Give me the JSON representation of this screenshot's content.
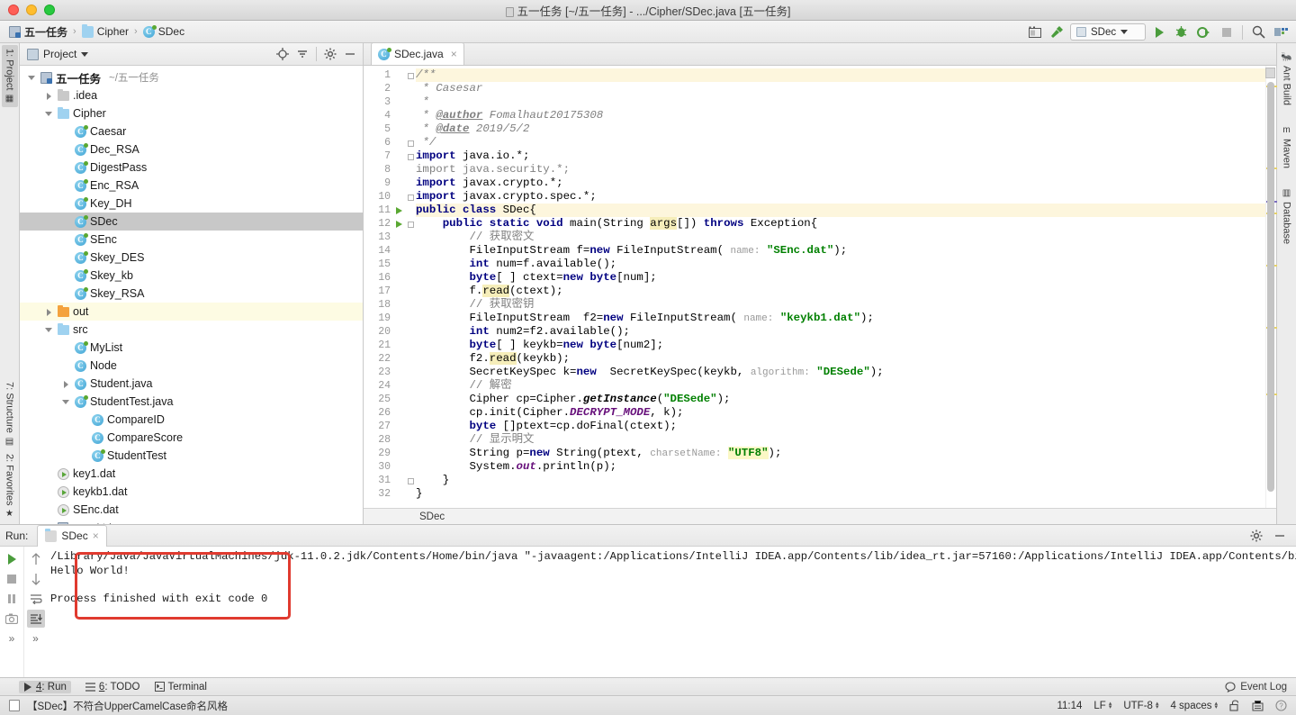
{
  "window": {
    "title": "五一任务 [~/五一任务] - .../Cipher/SDec.java [五一任务]",
    "traffic": [
      "close",
      "minimize",
      "maximize"
    ]
  },
  "breadcrumb": [
    {
      "label": "五一任务",
      "icon": "module-icon"
    },
    {
      "label": "Cipher",
      "icon": "folder-icon"
    },
    {
      "label": "SDec",
      "icon": "java-class-icon"
    }
  ],
  "toolbar": {
    "run_config": "SDec",
    "buttons": [
      "layout-icon",
      "build-icon",
      "run-icon",
      "debug-icon",
      "run-coverage-icon",
      "stop-icon",
      "search-icon",
      "project-structure-icon"
    ]
  },
  "left_rail": {
    "top": [
      "1: Project"
    ],
    "bottom": [
      "7: Structure",
      "2: Favorites"
    ]
  },
  "right_rail": [
    "Ant Build",
    "Maven",
    "Database"
  ],
  "project_panel": {
    "title": "Project",
    "header_buttons": [
      "locate-icon",
      "collapse-all-icon",
      "settings-icon",
      "hide-icon"
    ],
    "tree": [
      {
        "label": "五一任务",
        "suffix": "~/五一任务",
        "icon": "module-icon",
        "indent": 0,
        "arrow": "down",
        "bold": true,
        "state": "normal"
      },
      {
        "label": ".idea",
        "suffix": "",
        "icon": "folder-gray-icon",
        "indent": 1,
        "arrow": "right",
        "bold": false,
        "state": "normal"
      },
      {
        "label": "Cipher",
        "suffix": "",
        "icon": "folder-blue-icon",
        "indent": 1,
        "arrow": "down",
        "bold": false,
        "state": "normal"
      },
      {
        "label": "Caesar",
        "suffix": "",
        "icon": "java-class-icon",
        "indent": 2,
        "arrow": "none",
        "bold": false,
        "state": "normal"
      },
      {
        "label": "Dec_RSA",
        "suffix": "",
        "icon": "java-class-icon",
        "indent": 2,
        "arrow": "none",
        "bold": false,
        "state": "normal"
      },
      {
        "label": "DigestPass",
        "suffix": "",
        "icon": "java-class-icon",
        "indent": 2,
        "arrow": "none",
        "bold": false,
        "state": "normal"
      },
      {
        "label": "Enc_RSA",
        "suffix": "",
        "icon": "java-class-icon",
        "indent": 2,
        "arrow": "none",
        "bold": false,
        "state": "normal"
      },
      {
        "label": "Key_DH",
        "suffix": "",
        "icon": "java-class-icon",
        "indent": 2,
        "arrow": "none",
        "bold": false,
        "state": "normal"
      },
      {
        "label": "SDec",
        "suffix": "",
        "icon": "java-class-icon",
        "indent": 2,
        "arrow": "none",
        "bold": false,
        "state": "selected"
      },
      {
        "label": "SEnc",
        "suffix": "",
        "icon": "java-class-icon",
        "indent": 2,
        "arrow": "none",
        "bold": false,
        "state": "normal"
      },
      {
        "label": "Skey_DES",
        "suffix": "",
        "icon": "java-class-icon",
        "indent": 2,
        "arrow": "none",
        "bold": false,
        "state": "normal"
      },
      {
        "label": "Skey_kb",
        "suffix": "",
        "icon": "java-class-icon",
        "indent": 2,
        "arrow": "none",
        "bold": false,
        "state": "normal"
      },
      {
        "label": "Skey_RSA",
        "suffix": "",
        "icon": "java-class-icon",
        "indent": 2,
        "arrow": "none",
        "bold": false,
        "state": "normal"
      },
      {
        "label": "out",
        "suffix": "",
        "icon": "folder-orange-icon",
        "indent": 1,
        "arrow": "right",
        "bold": false,
        "state": "highlighted"
      },
      {
        "label": "src",
        "suffix": "",
        "icon": "folder-blue-icon",
        "indent": 1,
        "arrow": "down",
        "bold": false,
        "state": "normal"
      },
      {
        "label": "MyList",
        "suffix": "",
        "icon": "java-class-icon",
        "indent": 2,
        "arrow": "none",
        "bold": false,
        "state": "normal"
      },
      {
        "label": "Node",
        "suffix": "",
        "icon": "java-class-plain-icon",
        "indent": 2,
        "arrow": "none",
        "bold": false,
        "state": "normal"
      },
      {
        "label": "Student.java",
        "suffix": "",
        "icon": "java-class-plain-icon",
        "indent": 2,
        "arrow": "right",
        "bold": false,
        "state": "normal"
      },
      {
        "label": "StudentTest.java",
        "suffix": "",
        "icon": "java-class-icon",
        "indent": 2,
        "arrow": "down",
        "bold": false,
        "state": "normal"
      },
      {
        "label": "CompareID",
        "suffix": "",
        "icon": "java-class-plain-icon",
        "indent": 3,
        "arrow": "none",
        "bold": false,
        "state": "normal"
      },
      {
        "label": "CompareScore",
        "suffix": "",
        "icon": "java-class-plain-icon",
        "indent": 3,
        "arrow": "none",
        "bold": false,
        "state": "normal"
      },
      {
        "label": "StudentTest",
        "suffix": "",
        "icon": "java-class-icon",
        "indent": 3,
        "arrow": "none",
        "bold": false,
        "state": "normal"
      },
      {
        "label": "key1.dat",
        "suffix": "",
        "icon": "dat-file-icon",
        "indent": 1,
        "arrow": "none",
        "bold": false,
        "state": "normal"
      },
      {
        "label": "keykb1.dat",
        "suffix": "",
        "icon": "dat-file-icon",
        "indent": 1,
        "arrow": "none",
        "bold": false,
        "state": "normal"
      },
      {
        "label": "SEnc.dat",
        "suffix": "",
        "icon": "dat-file-icon",
        "indent": 1,
        "arrow": "none",
        "bold": false,
        "state": "normal"
      },
      {
        "label": "五一任务.iml",
        "suffix": "",
        "icon": "iml-file-icon",
        "indent": 1,
        "arrow": "none",
        "bold": false,
        "state": "normal"
      }
    ]
  },
  "editor": {
    "tab": {
      "label": "SDec.java",
      "icon": "java-class-icon",
      "close": "×"
    },
    "breadcrumb": "SDec",
    "first_line": 1,
    "last_line": 32,
    "lines": [
      {
        "n": 1,
        "html": "<span class=\"cm\">/**</span>",
        "run": false,
        "fold": "open",
        "hl": true
      },
      {
        "n": 2,
        "html": "<span class=\"cm\"> * Casesar</span>",
        "run": false,
        "fold": "",
        "hl": false
      },
      {
        "n": 3,
        "html": "<span class=\"cm\"> *</span>",
        "run": false,
        "fold": "",
        "hl": false
      },
      {
        "n": 4,
        "html": "<span class=\"cm\"> * </span><span class=\"tag\">@author</span><span class=\"cm\"> Fomalhaut20175308</span>",
        "run": false,
        "fold": "",
        "hl": false
      },
      {
        "n": 5,
        "html": "<span class=\"cm\"> * </span><span class=\"tag\">@date</span><span class=\"cm\"> 2019/5/2</span>",
        "run": false,
        "fold": "",
        "hl": false
      },
      {
        "n": 6,
        "html": "<span class=\"cm\"> */</span>",
        "run": false,
        "fold": "close",
        "hl": false
      },
      {
        "n": 7,
        "html": "<span class=\"kw\">import</span> java.io.*;",
        "run": false,
        "fold": "open",
        "hl": false
      },
      {
        "n": 8,
        "html": "<span class=\"cmt\">import java.security.*;</span>",
        "run": false,
        "fold": "",
        "hl": false
      },
      {
        "n": 9,
        "html": "<span class=\"kw\">import</span> javax.crypto.*;",
        "run": false,
        "fold": "",
        "hl": false
      },
      {
        "n": 10,
        "html": "<span class=\"kw\">import</span> javax.crypto.spec.*;",
        "run": false,
        "fold": "close",
        "hl": false
      },
      {
        "n": 11,
        "html": "<span class=\"kw\">public class</span> SDec{",
        "run": true,
        "fold": "",
        "hl": true
      },
      {
        "n": 12,
        "html": "    <span class=\"kw\">public static void</span> main(String <span class=\"hlw\">args</span>[]) <span class=\"kw\">throws</span> Exception{",
        "run": true,
        "fold": "open",
        "hl": false
      },
      {
        "n": 13,
        "html": "        <span class=\"cmt\">// 获取密文</span>",
        "run": false,
        "fold": "",
        "hl": false
      },
      {
        "n": 14,
        "html": "        FileInputStream f=<span class=\"kw\">new</span> FileInputStream( <span class=\"hint\">name:</span> <span class=\"str\">\"SEnc.dat\"</span>);",
        "run": false,
        "fold": "",
        "hl": false
      },
      {
        "n": 15,
        "html": "        <span class=\"kw\">int</span> num=f.available();",
        "run": false,
        "fold": "",
        "hl": false
      },
      {
        "n": 16,
        "html": "        <span class=\"kw\">byte</span>[ ] ctext=<span class=\"kw\">new</span> <span class=\"kw\">byte</span>[num];",
        "run": false,
        "fold": "",
        "hl": false
      },
      {
        "n": 17,
        "html": "        f.<span class=\"hlw\">read</span>(ctext);",
        "run": false,
        "fold": "",
        "hl": false
      },
      {
        "n": 18,
        "html": "        <span class=\"cmt\">// 获取密钥</span>",
        "run": false,
        "fold": "",
        "hl": false
      },
      {
        "n": 19,
        "html": "        FileInputStream  f2=<span class=\"kw\">new</span> FileInputStream( <span class=\"hint\">name:</span> <span class=\"str\">\"keykb1.dat\"</span>);",
        "run": false,
        "fold": "",
        "hl": false
      },
      {
        "n": 20,
        "html": "        <span class=\"kw\">int</span> num2=f2.available();",
        "run": false,
        "fold": "",
        "hl": false
      },
      {
        "n": 21,
        "html": "        <span class=\"kw\">byte</span>[ ] keykb=<span class=\"kw\">new</span> <span class=\"kw\">byte</span>[num2];",
        "run": false,
        "fold": "",
        "hl": false
      },
      {
        "n": 22,
        "html": "        f2.<span class=\"hlw\">read</span>(keykb);",
        "run": false,
        "fold": "",
        "hl": false
      },
      {
        "n": 23,
        "html": "        SecretKeySpec k=<span class=\"kw\">new</span>  SecretKeySpec(keykb, <span class=\"hint\">algorithm:</span> <span class=\"str\">\"DESede\"</span>);",
        "run": false,
        "fold": "",
        "hl": false
      },
      {
        "n": 24,
        "html": "        <span class=\"cmt\">// 解密</span>",
        "run": false,
        "fold": "",
        "hl": false
      },
      {
        "n": 25,
        "html": "        Cipher cp=Cipher.<span class=\"ital\">getInstance</span>(<span class=\"str\">\"DESede\"</span>);",
        "run": false,
        "fold": "",
        "hl": false
      },
      {
        "n": 26,
        "html": "        cp.init(Cipher.<span class=\"field\">DECRYPT_MODE</span>, k);",
        "run": false,
        "fold": "",
        "hl": false
      },
      {
        "n": 27,
        "html": "        <span class=\"kw\">byte</span> []ptext=cp.doFinal(ctext);",
        "run": false,
        "fold": "",
        "hl": false
      },
      {
        "n": 28,
        "html": "        <span class=\"cmt\">// 显示明文</span>",
        "run": false,
        "fold": "",
        "hl": false
      },
      {
        "n": 29,
        "html": "        String p=<span class=\"kw\">new</span> String(ptext, <span class=\"hint\">charsetName:</span> <span class=\"strh\">\"UTF8\"</span>);",
        "run": false,
        "fold": "",
        "hl": false
      },
      {
        "n": 30,
        "html": "        System.<span class=\"field\">out</span>.println(p);",
        "run": false,
        "fold": "",
        "hl": false
      },
      {
        "n": 31,
        "html": "    }",
        "run": false,
        "fold": "close",
        "hl": false
      },
      {
        "n": 32,
        "html": "}",
        "run": false,
        "fold": "",
        "hl": false
      }
    ]
  },
  "run_panel": {
    "label": "Run:",
    "tab": "SDec",
    "toolbar_left": [
      "rerun-icon",
      "stop-icon",
      "pause-icon",
      "screenshot-icon",
      "expand-icon"
    ],
    "toolbar_right": [
      "up-icon",
      "down-icon",
      "soft-wrap-icon",
      "scroll-to-end-icon",
      "more-icon"
    ],
    "header_right": [
      "settings-icon",
      "hide-icon"
    ],
    "console": [
      "/Library/Java/JavaVirtualMachines/jdk-11.0.2.jdk/Contents/Home/bin/java \"-javaagent:/Applications/IntelliJ IDEA.app/Contents/lib/idea_rt.jar=57160:/Applications/IntelliJ IDEA.app/Contents/bi",
      "Hello World!",
      "",
      "Process finished with exit code 0"
    ],
    "annotation_color": "#e03a2f"
  },
  "bottom_bar": {
    "items": [
      {
        "label": "4: Run",
        "num": "4",
        "icon": "run-icon",
        "selected": true
      },
      {
        "label": "6: TODO",
        "num": "6",
        "icon": "todo-icon",
        "selected": false
      },
      {
        "label": "Terminal",
        "num": "",
        "icon": "terminal-icon",
        "selected": false
      }
    ],
    "event_log": "Event Log"
  },
  "status_bar": {
    "message": "【SDec】不符合UpperCamelCase命名风格",
    "caret": "11:14",
    "line_sep": "LF",
    "encoding": "UTF-8",
    "indent": "4 spaces",
    "icons": [
      "lock-open-icon",
      "inspection-icon",
      "help-icon"
    ]
  }
}
